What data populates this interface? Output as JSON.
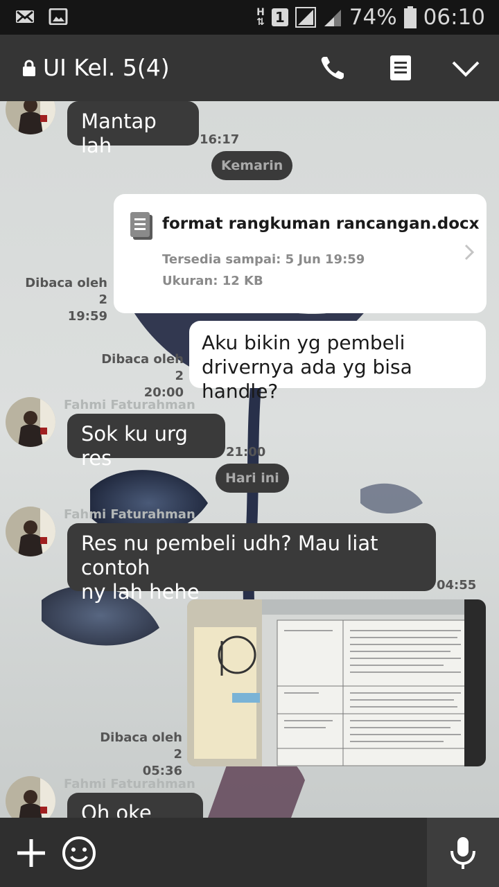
{
  "status_bar": {
    "icons_left": [
      "mail-icon",
      "image-icon"
    ],
    "hd_label": "H",
    "sim_label": "1",
    "battery": "74%",
    "time": "06:10"
  },
  "header": {
    "title": "UI Kel. 5(4)",
    "icons": [
      "lock-icon",
      "phone-icon",
      "notes-icon",
      "chevron-down-icon"
    ]
  },
  "messages": {
    "m1": {
      "text": "Mantap lah",
      "time": "16:17"
    },
    "sep1": "Kemarin",
    "file": {
      "name": "format rangkuman rancangan.docx",
      "available": "Tersedia sampai: 5 Jun 19:59",
      "size": "Ukuran: 12 KB",
      "read": "Dibaca oleh 2",
      "time": "19:59"
    },
    "m2": {
      "line1": "Aku bikin yg pembeli",
      "line2": "drivernya ada yg bisa handle?",
      "read": "Dibaca oleh 2",
      "time": "20:00"
    },
    "m3": {
      "sender": "Fahmi Faturahman",
      "text": "Sok ku urg res",
      "time": "21:00"
    },
    "sep2": "Hari ini",
    "m4": {
      "sender": "Fahmi Faturahman",
      "line1": "Res nu pembeli udh? Mau liat contoh",
      "line2": "ny lah hehe",
      "time": "04:55"
    },
    "m5": {
      "read": "Dibaca oleh 2",
      "time": "05:36"
    },
    "m6": {
      "sender": "Fahmi Faturahman",
      "text": "Oh oke siap"
    }
  },
  "input_bar": {
    "icons": [
      "plus-icon",
      "emoji-icon",
      "microphone-icon"
    ]
  },
  "colors": {
    "header_bg": "#353535",
    "incoming_bubble": "#3a3a3a",
    "outgoing_bubble": "#ffffff",
    "status_bar_bg": "#151515"
  }
}
